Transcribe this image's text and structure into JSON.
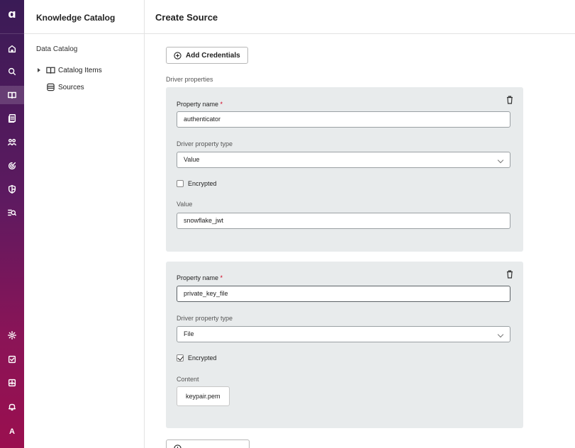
{
  "rail": {
    "logo": "ɑ",
    "avatar_letter": "A",
    "items": [
      {
        "icon": "home-icon"
      },
      {
        "icon": "search-icon"
      },
      {
        "icon": "book-icon",
        "active": true
      },
      {
        "icon": "document-icon"
      },
      {
        "icon": "people-icon"
      },
      {
        "icon": "radar-icon"
      },
      {
        "icon": "shield-icon"
      },
      {
        "icon": "eq-search-icon"
      }
    ],
    "bottom_items": [
      {
        "icon": "gear-icon"
      },
      {
        "icon": "checkbox-icon"
      },
      {
        "icon": "import-icon"
      },
      {
        "icon": "bell-icon"
      }
    ]
  },
  "sidebar": {
    "title": "Knowledge Catalog",
    "section": "Data Catalog",
    "items": [
      {
        "label": "Catalog Items",
        "icon": "book-icon"
      },
      {
        "label": "Sources",
        "icon": "database-icon"
      }
    ]
  },
  "main": {
    "title": "Create Source",
    "add_credentials_label": "Add Credentials",
    "driver_properties_label": "Driver properties",
    "cards": [
      {
        "property_name_label": "Property name",
        "required_mark": "*",
        "property_name_value": "authenticator",
        "type_label": "Driver property type",
        "type_value": "Value",
        "encrypted_label": "Encrypted",
        "encrypted": false,
        "value_label": "Value",
        "value_value": "snowflake_jwt"
      },
      {
        "property_name_label": "Property name",
        "required_mark": "*",
        "property_name_value": "private_key_file",
        "type_label": "Driver property type",
        "type_value": "File",
        "encrypted_label": "Encrypted",
        "encrypted": true,
        "content_label": "Content",
        "content_value": "keypair.pem"
      }
    ]
  },
  "colors": {
    "rail_top": "#3a1b56",
    "rail_bottom": "#9a0f4f",
    "card_bg": "#e8ebec",
    "required": "#d1001f"
  }
}
